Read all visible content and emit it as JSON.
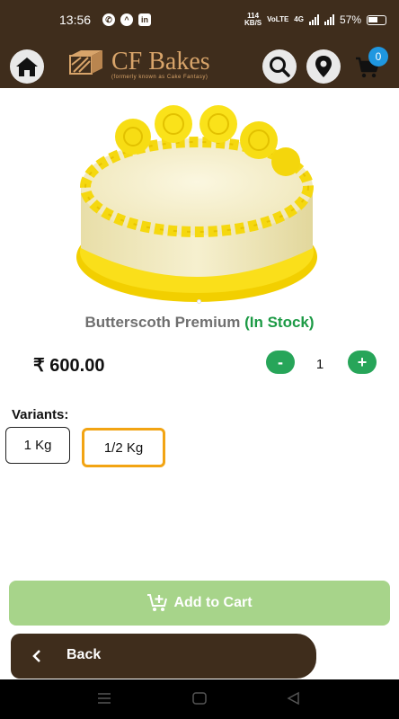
{
  "status_bar": {
    "time": "13:56",
    "net_speed": "114\nKB/S",
    "network_label": "VoLTE",
    "signal_label": "4G",
    "battery": "57%"
  },
  "header": {
    "brand_name": "CF Bakes",
    "tagline": "(formerly known as Cake Fantasy)",
    "cart_count": "0"
  },
  "product": {
    "name": "Butterscoth Premium",
    "stock_status": "(In Stock)",
    "price": "₹ 600.00",
    "quantity": "1",
    "minus_label": "-",
    "plus_label": "+"
  },
  "variants": {
    "label": "Variants:",
    "options": [
      "1 Kg",
      "1/2 Kg"
    ],
    "selected": "1/2 Kg"
  },
  "actions": {
    "add_to_cart": "Add to Cart",
    "back": "Back"
  },
  "colors": {
    "header_bg": "#3f2d1c",
    "accent_green": "#27a559",
    "add_cart_bg": "#a7d48a",
    "selected_variant_border": "#f2a413",
    "badge": "#1f97e0"
  }
}
